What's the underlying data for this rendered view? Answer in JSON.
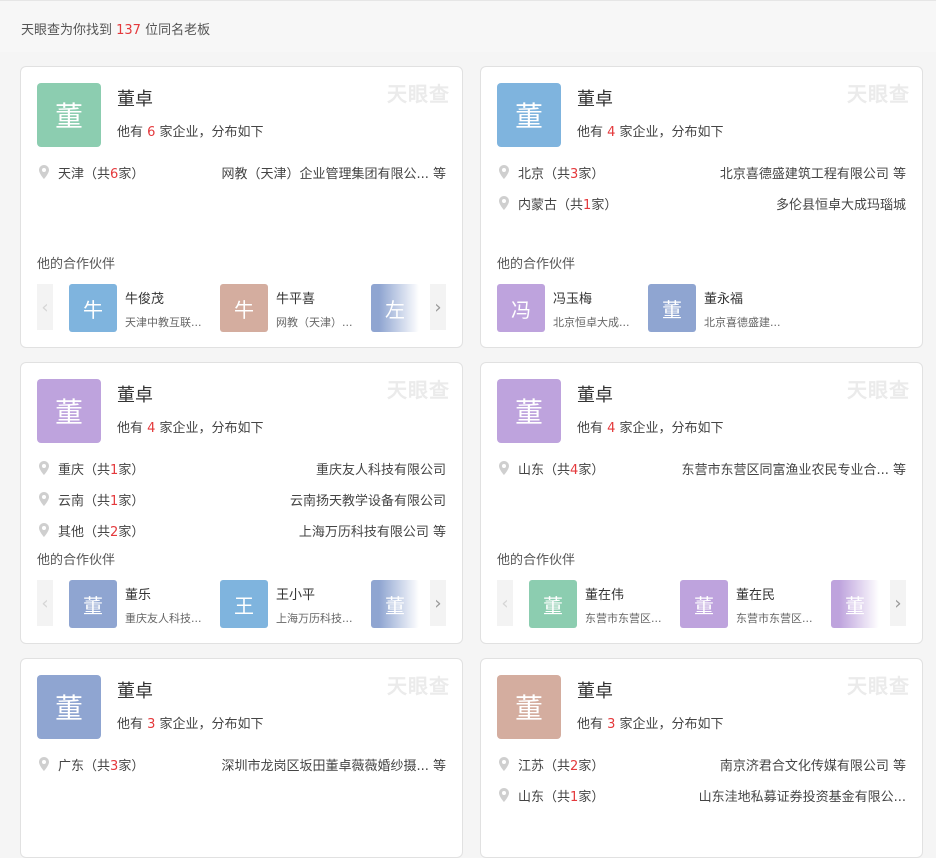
{
  "summary": {
    "prefix": "天眼查为你找到 ",
    "count": "137",
    "suffix": " 位同名老板"
  },
  "watermark": "天眼查",
  "colors": {
    "green": "#8ccdb0",
    "blue": "#7fb4de",
    "purple": "#bea3dd",
    "slate": "#8fa5d1",
    "tan": "#d4ad9f",
    "accent": "#e4393c"
  },
  "cards": [
    {
      "avatar_char": "董",
      "name": "董卓",
      "count": "6",
      "sub_prefix": "他有 ",
      "sub_suffix": " 家企业，分布如下",
      "locations": [
        {
          "region": "天津",
          "count": "6",
          "company": "网教（天津）企业管理集团有限公... 等"
        }
      ],
      "partners_title": "他的合作伙伴",
      "partners": [
        {
          "char": "牛",
          "name": "牛俊茂",
          "company": "天津中教互联..."
        },
        {
          "char": "牛",
          "name": "牛平喜",
          "company": "网教（天津）..."
        },
        {
          "char": "左",
          "name": "",
          "company": ""
        }
      ]
    },
    {
      "avatar_char": "董",
      "name": "董卓",
      "count": "4",
      "sub_prefix": "他有 ",
      "sub_suffix": " 家企业，分布如下",
      "locations": [
        {
          "region": "北京",
          "count": "3",
          "company": "北京喜德盛建筑工程有限公司 等"
        },
        {
          "region": "内蒙古",
          "count": "1",
          "company": "多伦县恒卓大成玛瑙城"
        }
      ],
      "partners_title": "他的合作伙伴",
      "partners": [
        {
          "char": "冯",
          "name": "冯玉梅",
          "company": "北京恒卓大成..."
        },
        {
          "char": "董",
          "name": "董永福",
          "company": "北京喜德盛建..."
        }
      ]
    },
    {
      "avatar_char": "董",
      "name": "董卓",
      "count": "4",
      "sub_prefix": "他有 ",
      "sub_suffix": " 家企业，分布如下",
      "locations": [
        {
          "region": "重庆",
          "count": "1",
          "company": "重庆友人科技有限公司"
        },
        {
          "region": "云南",
          "count": "1",
          "company": "云南扬天教学设备有限公司"
        },
        {
          "region": "其他",
          "count": "2",
          "company": "上海万历科技有限公司 等"
        }
      ],
      "partners_title": "他的合作伙伴",
      "partners": [
        {
          "char": "董",
          "name": "董乐",
          "company": "重庆友人科技..."
        },
        {
          "char": "王",
          "name": "王小平",
          "company": "上海万历科技..."
        },
        {
          "char": "董",
          "name": "",
          "company": ""
        }
      ]
    },
    {
      "avatar_char": "董",
      "name": "董卓",
      "count": "4",
      "sub_prefix": "他有 ",
      "sub_suffix": " 家企业，分布如下",
      "locations": [
        {
          "region": "山东",
          "count": "4",
          "company": "东营市东营区同富渔业农民专业合... 等"
        }
      ],
      "partners_title": "他的合作伙伴",
      "partners": [
        {
          "char": "董",
          "name": "董在伟",
          "company": "东营市东营区..."
        },
        {
          "char": "董",
          "name": "董在民",
          "company": "东营市东营区..."
        },
        {
          "char": "董",
          "name": "",
          "company": ""
        }
      ]
    },
    {
      "avatar_char": "董",
      "name": "董卓",
      "count": "3",
      "sub_prefix": "他有 ",
      "sub_suffix": " 家企业，分布如下",
      "locations": [
        {
          "region": "广东",
          "count": "3",
          "company": "深圳市龙岗区坂田董卓薇薇婚纱摄... 等"
        }
      ]
    },
    {
      "avatar_char": "董",
      "name": "董卓",
      "count": "3",
      "sub_prefix": "他有 ",
      "sub_suffix": " 家企业，分布如下",
      "locations": [
        {
          "region": "江苏",
          "count": "2",
          "company": "南京济君合文化传媒有限公司 等"
        },
        {
          "region": "山东",
          "count": "1",
          "company": "山东洼地私募证券投资基金有限公..."
        }
      ]
    }
  ],
  "region_open": "（共",
  "region_close": "家）",
  "arrow_left": "‹",
  "arrow_right": "›"
}
